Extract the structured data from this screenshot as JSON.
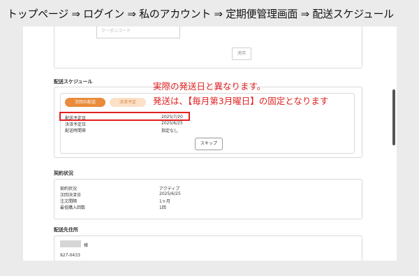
{
  "breadcrumb": "トップページ ⇒ ログイン ⇒ 私のアカウント ⇒ 定期便管理画面 ⇒ 配送スケジュール",
  "coupon": {
    "placeholder": "クーポンコード",
    "apply_label": "適用"
  },
  "schedule": {
    "title": "配送スケジュール",
    "tab_next_delivery": "次回の配送",
    "tab_payment_plan": "決済予定",
    "rows": [
      {
        "label": "配送予定日",
        "value": "2025/7/20"
      },
      {
        "label": "決済予定日",
        "value": "2025/6/25"
      },
      {
        "label": "配送時間帯",
        "value": "指定なし"
      }
    ],
    "skip_label": "スキップ"
  },
  "annotation": {
    "line1": "実際の発送日と異なります。",
    "line2": "発送は、【毎月第3月曜日】の固定となります"
  },
  "contract": {
    "title": "契約状況",
    "rows": [
      {
        "label": "契約状況",
        "value": "アクティブ"
      },
      {
        "label": "次回決済日",
        "value": "2025/6/25"
      },
      {
        "label": "注文間隔",
        "value": "1ヶ月"
      },
      {
        "label": "最低購入回数",
        "value": "1回"
      }
    ]
  },
  "address": {
    "title": "配送先住所",
    "honorific": "様",
    "postal": "927-0433"
  },
  "colors": {
    "accent": "#e98b3a",
    "annotation": "#e02020"
  }
}
